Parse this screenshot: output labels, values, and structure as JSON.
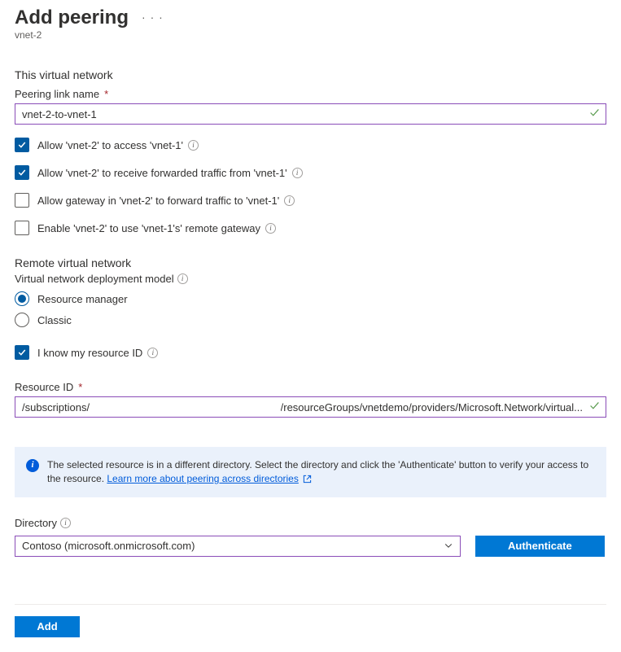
{
  "header": {
    "title": "Add peering",
    "subtitle": "vnet-2"
  },
  "thisVnet": {
    "sectionLabel": "This virtual network",
    "peeringLinkNameLabel": "Peering link name",
    "peeringLinkNameValue": "vnet-2-to-vnet-1",
    "options": [
      {
        "label": "Allow 'vnet-2' to access 'vnet-1'",
        "checked": true
      },
      {
        "label": "Allow 'vnet-2' to receive forwarded traffic from 'vnet-1'",
        "checked": true
      },
      {
        "label": "Allow gateway in 'vnet-2' to forward traffic to 'vnet-1'",
        "checked": false
      },
      {
        "label": "Enable 'vnet-2' to use 'vnet-1's' remote gateway",
        "checked": false
      }
    ]
  },
  "remoteVnet": {
    "sectionLabel": "Remote virtual network",
    "deploymentModelLabel": "Virtual network deployment model",
    "models": [
      {
        "label": "Resource manager",
        "selected": true
      },
      {
        "label": "Classic",
        "selected": false
      }
    ],
    "knowResourceId": {
      "label": "I know my resource ID",
      "checked": true
    },
    "resourceIdLabel": "Resource ID",
    "resourceIdValueLeft": "/subscriptions/",
    "resourceIdValueRight": "/resourceGroups/vnetdemo/providers/Microsoft.Network/virtual..."
  },
  "banner": {
    "text": "The selected resource is in a different directory. Select the directory and click the 'Authenticate' button to verify your access to the resource. ",
    "linkText": "Learn more about peering across directories"
  },
  "directory": {
    "label": "Directory",
    "selected": "Contoso (microsoft.onmicrosoft.com)",
    "authenticateLabel": "Authenticate"
  },
  "footer": {
    "addLabel": "Add"
  }
}
